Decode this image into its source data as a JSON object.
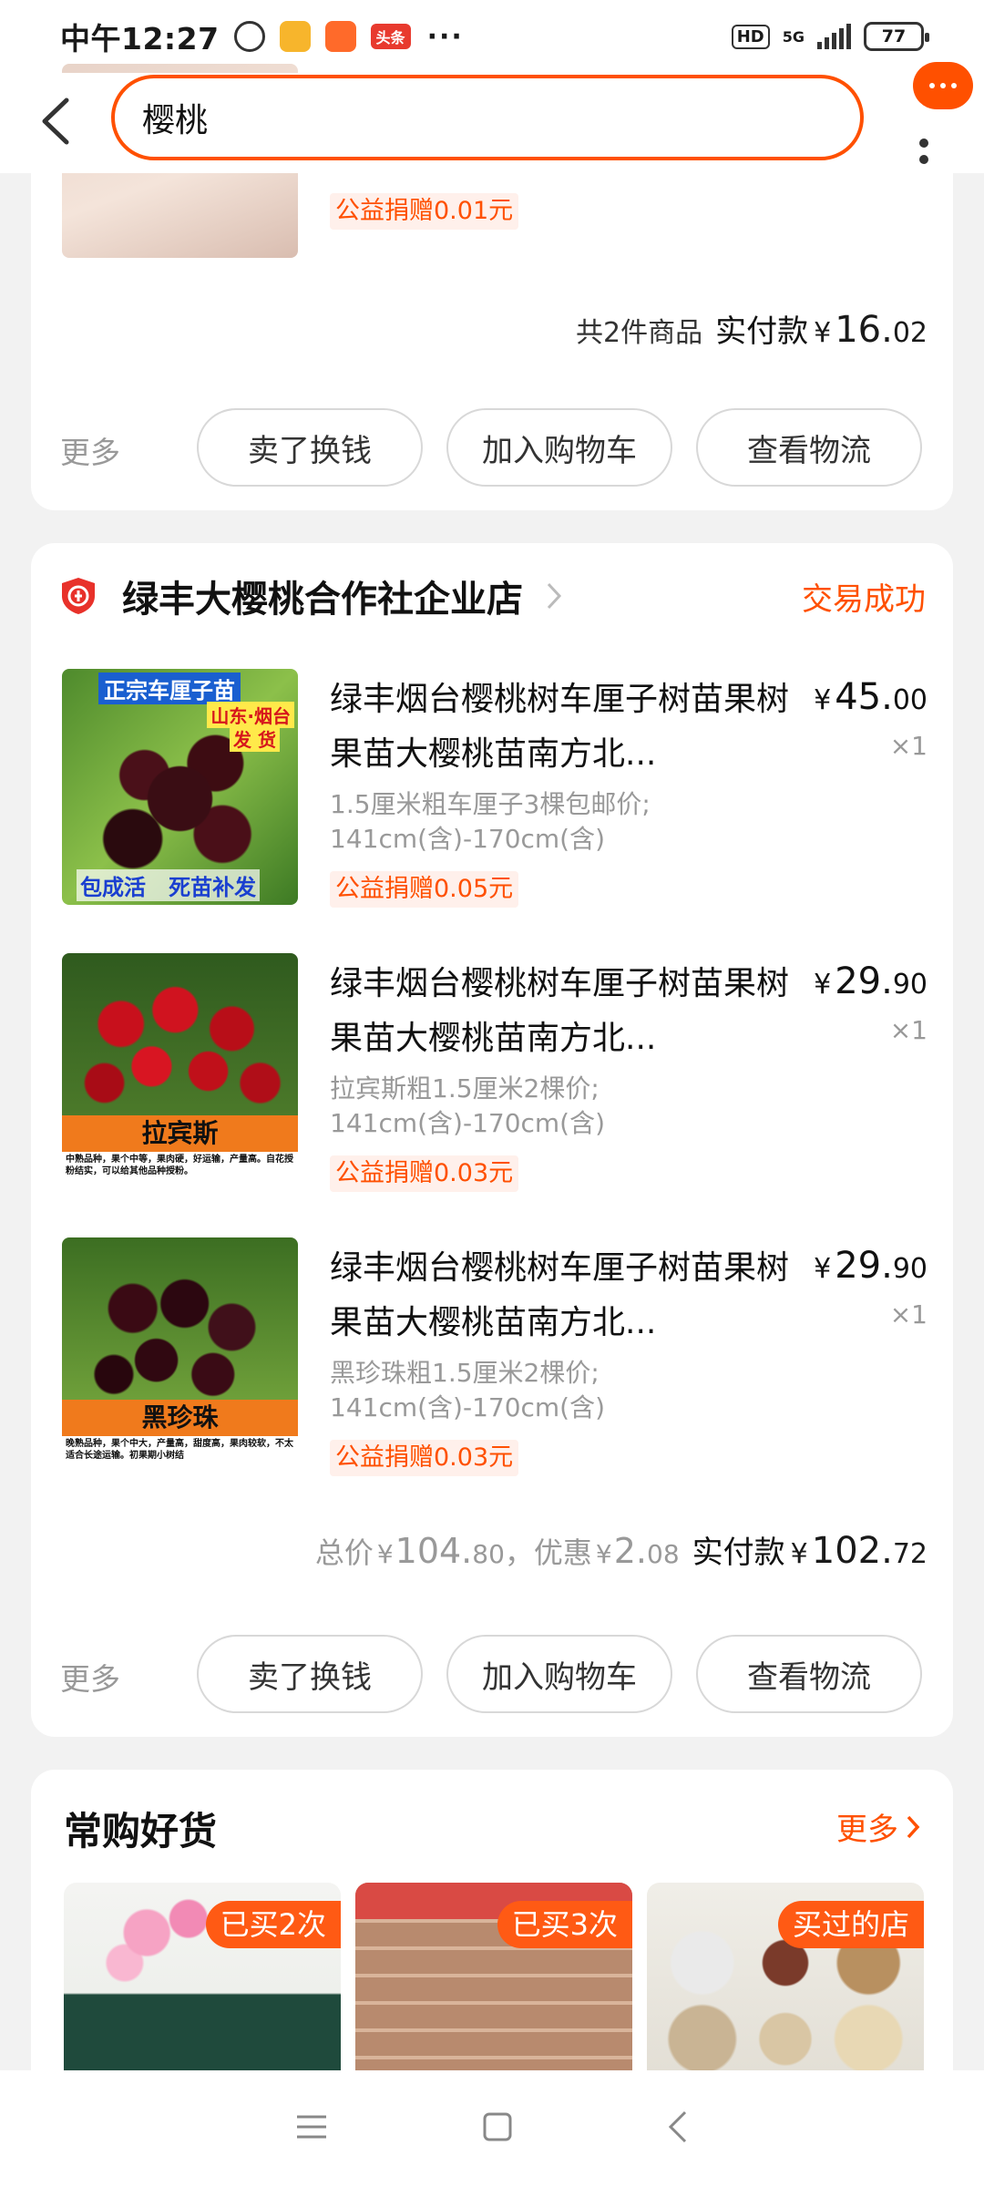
{
  "status_bar": {
    "time": "中午12:27",
    "app_badge": "头条",
    "more": "···",
    "hd": "HD",
    "network": "5G",
    "battery": "77"
  },
  "header": {
    "search_value": "樱桃"
  },
  "order1": {
    "donation": "公益捐赠0.01元",
    "count_text": "共2件商品",
    "paid_label": "实付款",
    "paid": {
      "yen": "¥",
      "int": "16.",
      "dec": "02"
    },
    "actions": {
      "more": "更多",
      "sell": "卖了换钱",
      "cart": "加入购物车",
      "logistics": "查看物流"
    }
  },
  "order2": {
    "shop_name": "绿丰大樱桃合作社企业店",
    "status": "交易成功",
    "items": [
      {
        "title": "绿丰烟台樱桃树车厘子树苗果树果苗大樱桃苗南方北...",
        "sku_line1": "1.5厘米粗车厘子3棵包邮价;",
        "sku_line2": "141cm(含)-170cm(含)",
        "donation": "公益捐赠0.05元",
        "price_int": "45.",
        "price_dec": "00",
        "qty": "×1",
        "img_top": "正宗车厘子苗",
        "img_mid": "山东·烟台",
        "img_mid2": "发 货",
        "img_bottom": "包成活   死苗补发"
      },
      {
        "title": "绿丰烟台樱桃树车厘子树苗果树果苗大樱桃苗南方北...",
        "sku_line1": "拉宾斯粗1.5厘米2棵价;",
        "sku_line2": "141cm(含)-170cm(含)",
        "donation": "公益捐赠0.03元",
        "price_int": "29.",
        "price_dec": "90",
        "qty": "×1",
        "img_label": "拉宾斯",
        "img_desc": "中熟品种，果个中等，果肉硬，好运输，产量高。自花授粉结实，可以给其他品种授粉。"
      },
      {
        "title": "绿丰烟台樱桃树车厘子树苗果树果苗大樱桃苗南方北...",
        "sku_line1": "黑珍珠粗1.5厘米2棵价;",
        "sku_line2": "141cm(含)-170cm(含)",
        "donation": "公益捐赠0.03元",
        "price_int": "29.",
        "price_dec": "90",
        "qty": "×1",
        "img_label": "黑珍珠",
        "img_desc": "晚熟品种，果个中大，产量高，甜度高，果肉较软，不太适合长途运输。初果期小树结"
      }
    ],
    "total_label": "总价",
    "total": {
      "yen": "¥",
      "int": "104.",
      "dec": "80"
    },
    "discount_label": "，优惠",
    "discount": {
      "yen": "¥",
      "int": "2.",
      "dec": "08"
    },
    "paid_label": "实付款",
    "paid": {
      "yen": "¥",
      "int": "102.",
      "dec": "72"
    },
    "actions": {
      "more": "更多",
      "sell": "卖了换钱",
      "cart": "加入购物车",
      "logistics": "查看物流"
    }
  },
  "frequent": {
    "title": "常购好货",
    "more": "更多",
    "goods": [
      {
        "badge": "已买2次"
      },
      {
        "badge": "已买3次"
      },
      {
        "badge": "买过的店"
      }
    ]
  }
}
